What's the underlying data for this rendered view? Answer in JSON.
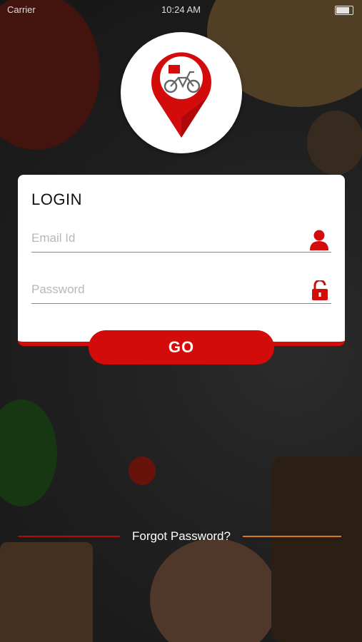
{
  "status_bar": {
    "carrier": "Carrier",
    "time": "10:24 AM"
  },
  "login": {
    "title": "LOGIN",
    "email_placeholder": "Email Id",
    "password_placeholder": "Password",
    "go_label": "GO"
  },
  "forgot": {
    "label": "Forgot Password?"
  },
  "icons": {
    "user": "user-icon",
    "lock": "unlock-icon",
    "logo": "delivery-location-pin-logo"
  },
  "colors": {
    "accent": "#d40b0b",
    "orange_line": "#d77a20",
    "card": "#ffffff"
  }
}
